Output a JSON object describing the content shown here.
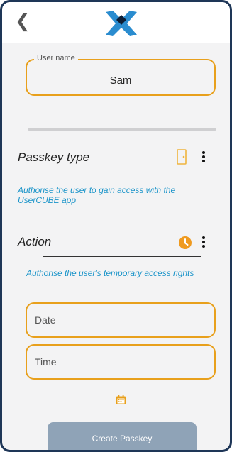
{
  "username": {
    "label": "User name",
    "value": "Sam"
  },
  "passkey_type": {
    "title": "Passkey type",
    "description": "Authorise the user to gain access with the UserCUBE app"
  },
  "action": {
    "title": "Action",
    "description": "Authorise the user's temporary access rights"
  },
  "date": {
    "placeholder": "Date"
  },
  "time": {
    "placeholder": "Time"
  },
  "create_button": {
    "label": "Create Passkey"
  },
  "colors": {
    "accent": "#e8a01c",
    "link": "#1a94c9",
    "button": "#8fa3b7",
    "frame": "#1e3657"
  },
  "icons": {
    "back": "chevron-left-icon",
    "logo": "x-cross-logo",
    "passkey": "phone-door-icon",
    "action": "clock-icon",
    "calendar": "calendar-icon",
    "menu": "more-vert-icon"
  }
}
